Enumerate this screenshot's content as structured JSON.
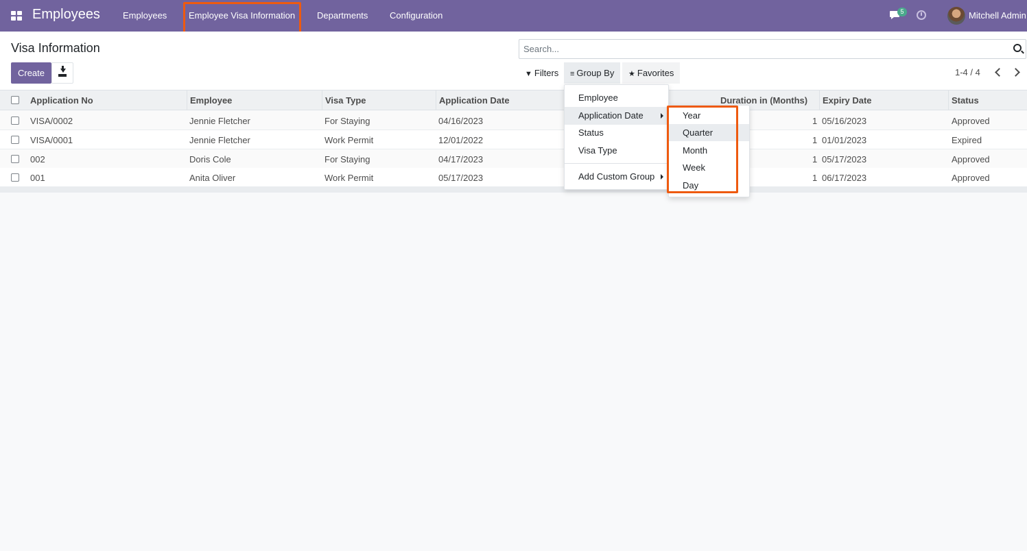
{
  "navbar": {
    "brand": "Employees",
    "menu": [
      {
        "label": "Employees"
      },
      {
        "label": "Employee Visa Information"
      },
      {
        "label": "Departments"
      },
      {
        "label": "Configuration"
      }
    ],
    "messages_count": "5",
    "user_name": "Mitchell Admin"
  },
  "control_panel": {
    "title": "Visa Information",
    "create_label": "Create",
    "search_placeholder": "Search...",
    "filters_label": "Filters",
    "groupby_label": "Group By",
    "favorites_label": "Favorites",
    "pager_text": "1-4 / 4"
  },
  "table": {
    "columns": [
      "Application No",
      "Employee",
      "Visa Type",
      "Application Date",
      "Duration in (Months)",
      "Expiry Date",
      "Status"
    ],
    "rows": [
      {
        "app_no": "VISA/0002",
        "employee": "Jennie Fletcher",
        "visa_type": "For Staying",
        "app_date": "04/16/2023",
        "duration": "1",
        "expiry": "05/16/2023",
        "status": "Approved"
      },
      {
        "app_no": "VISA/0001",
        "employee": "Jennie Fletcher",
        "visa_type": "Work Permit",
        "app_date": "12/01/2022",
        "duration": "1",
        "expiry": "01/01/2023",
        "status": "Expired"
      },
      {
        "app_no": "002",
        "employee": "Doris Cole",
        "visa_type": "For Staying",
        "app_date": "04/17/2023",
        "duration": "1",
        "expiry": "05/17/2023",
        "status": "Approved"
      },
      {
        "app_no": "001",
        "employee": "Anita Oliver",
        "visa_type": "Work Permit",
        "app_date": "05/17/2023",
        "duration": "1",
        "expiry": "06/17/2023",
        "status": "Approved"
      }
    ]
  },
  "groupby_menu": {
    "items": [
      "Employee",
      "Application Date",
      "Status",
      "Visa Type"
    ],
    "custom_group_label": "Add Custom Group",
    "active_item": "Application Date"
  },
  "date_submenu": {
    "items": [
      "Year",
      "Quarter",
      "Month",
      "Week",
      "Day"
    ],
    "active_item": "Quarter"
  },
  "colors": {
    "navbar": "#71639e",
    "highlight": "#ee5a0f",
    "primary_button": "#71639e"
  }
}
